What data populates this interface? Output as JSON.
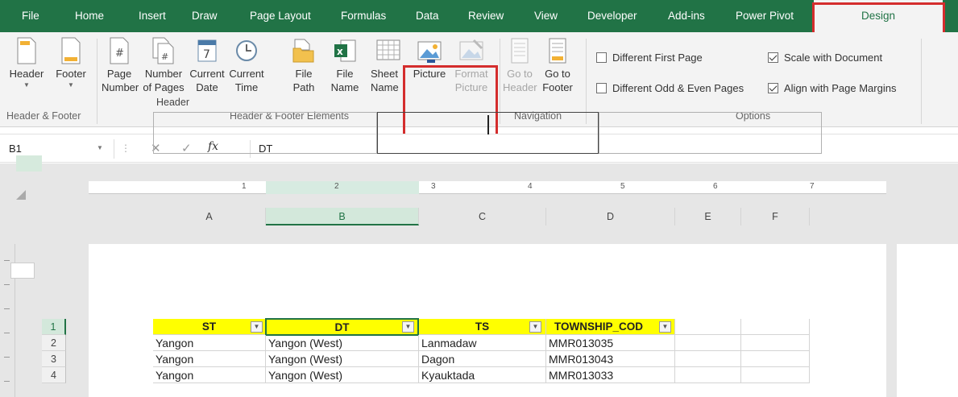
{
  "tabs": [
    {
      "label": "File"
    },
    {
      "label": "Home"
    },
    {
      "label": "Insert"
    },
    {
      "label": "Draw"
    },
    {
      "label": "Page Layout"
    },
    {
      "label": "Formulas"
    },
    {
      "label": "Data"
    },
    {
      "label": "Review"
    },
    {
      "label": "View"
    },
    {
      "label": "Developer"
    },
    {
      "label": "Add-ins"
    },
    {
      "label": "Power Pivot"
    },
    {
      "label": "Design",
      "active": true
    }
  ],
  "ribbon": {
    "header_footer_group": {
      "label": "Header & Footer",
      "header": "Header",
      "footer": "Footer"
    },
    "elements_group": {
      "label": "Header & Footer Elements",
      "page_number": [
        "Page",
        "Number"
      ],
      "number_of_pages": [
        "Number",
        "of Pages"
      ],
      "current_date": [
        "Current",
        "Date"
      ],
      "current_time": [
        "Current",
        "Time"
      ],
      "file_path": [
        "File",
        "Path"
      ],
      "file_name": [
        "File",
        "Name"
      ],
      "sheet_name": [
        "Sheet",
        "Name"
      ],
      "picture": "Picture",
      "format_picture": [
        "Format",
        "Picture"
      ]
    },
    "navigation_group": {
      "label": "Navigation",
      "go_to_header": [
        "Go to",
        "Header"
      ],
      "go_to_footer": [
        "Go to",
        "Footer"
      ]
    },
    "options_group": {
      "label": "Options",
      "different_first_page": {
        "label": "Different First Page",
        "checked": false
      },
      "different_odd_even": {
        "label": "Different Odd & Even Pages",
        "checked": false
      },
      "scale_with_document": {
        "label": "Scale with Document",
        "checked": true
      },
      "align_with_margins": {
        "label": "Align with Page Margins",
        "checked": true
      }
    }
  },
  "formula_bar": {
    "name_box": "B1",
    "fx_label": "fx",
    "content": "DT"
  },
  "ruler": {
    "numbers": [
      "1",
      "2",
      "3",
      "4",
      "5",
      "6",
      "7"
    ]
  },
  "columns": [
    "A",
    "B",
    "C",
    "D",
    "E",
    "F"
  ],
  "header_area": {
    "label": "Header"
  },
  "table": {
    "headers": [
      "ST",
      "DT",
      "TS",
      "TOWNSHIP_COD"
    ],
    "rows": [
      {
        "num": "2",
        "cells": [
          "Yangon",
          "Yangon (West)",
          "Lanmadaw",
          "MMR013035"
        ]
      },
      {
        "num": "3",
        "cells": [
          "Yangon",
          "Yangon (West)",
          "Dagon",
          "MMR013043"
        ]
      },
      {
        "num": "4",
        "cells": [
          "Yangon",
          "Yangon (West)",
          "Kyauktada",
          "MMR013033"
        ]
      }
    ],
    "header_row_num": "1"
  },
  "colors": {
    "accent": "#217346",
    "highlight": "#d42d2d",
    "header_fill": "#ffff00"
  }
}
